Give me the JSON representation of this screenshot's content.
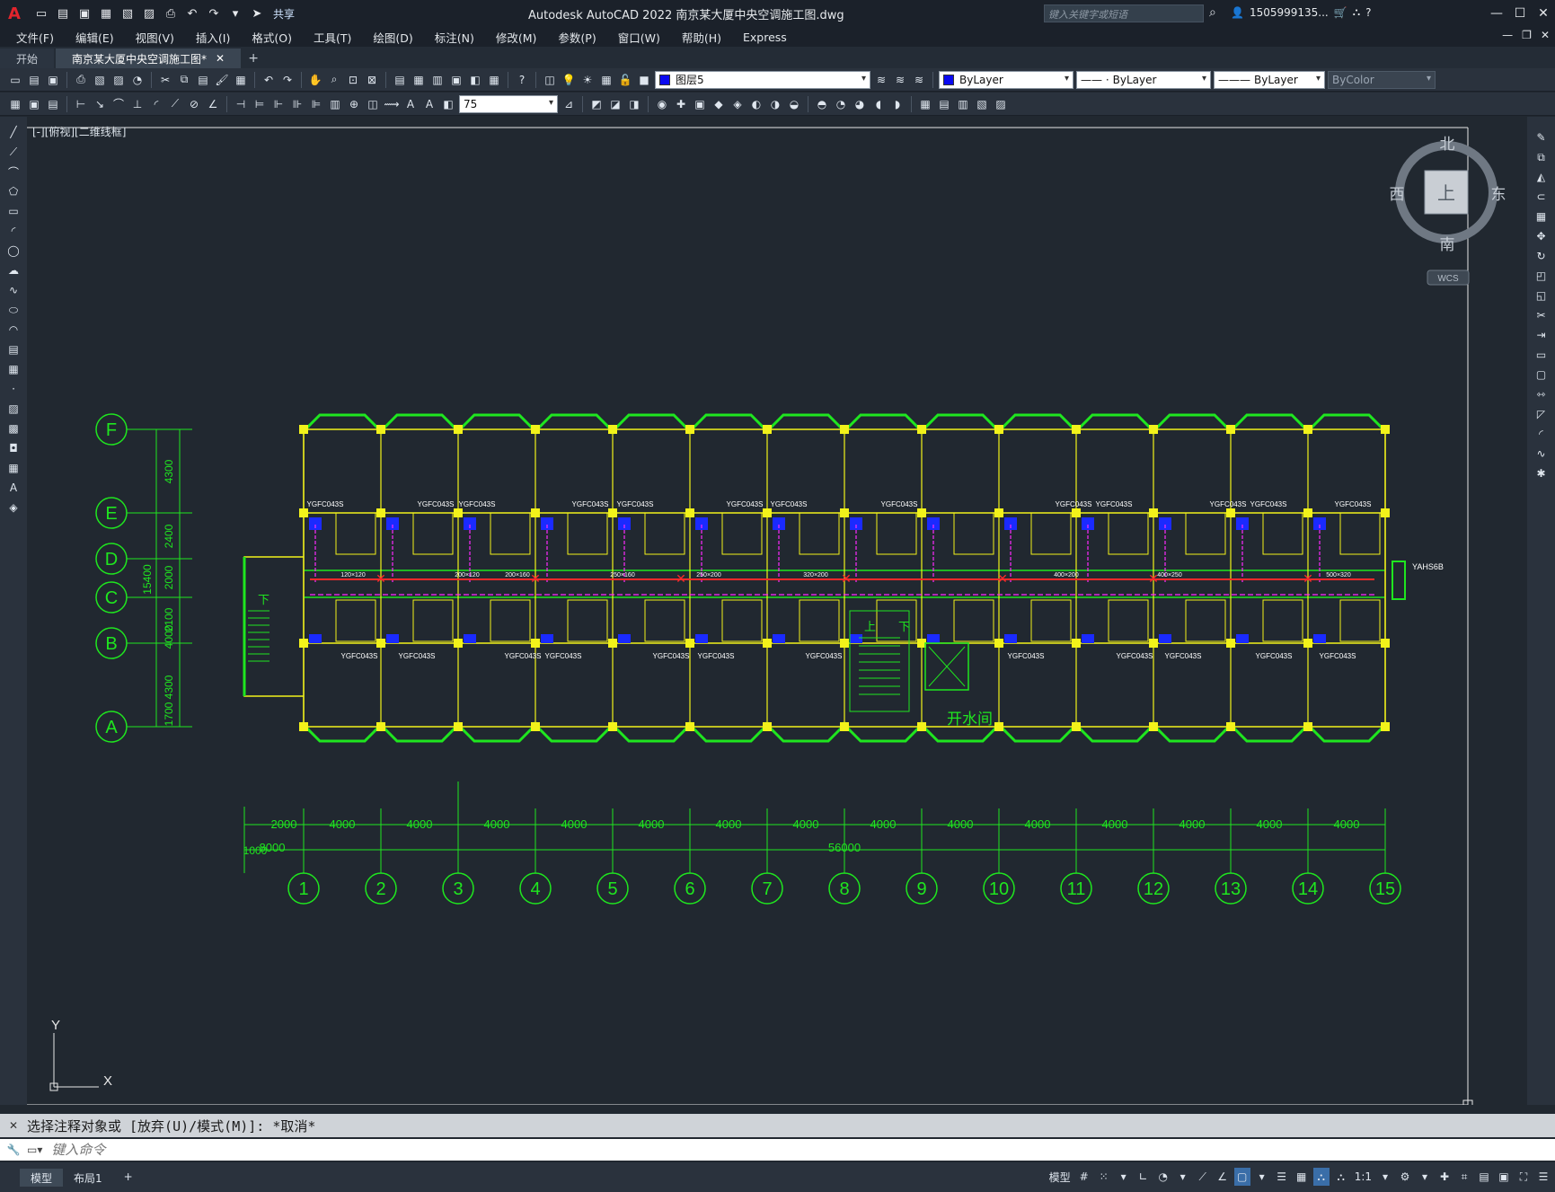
{
  "app": {
    "title": "Autodesk AutoCAD 2022    南京某大厦中央空调施工图.dwg",
    "share_label": "共享",
    "search_placeholder": "键入关键字或短语",
    "user": "1505999135...",
    "menus": [
      "文件(F)",
      "编辑(E)",
      "视图(V)",
      "插入(I)",
      "格式(O)",
      "工具(T)",
      "绘图(D)",
      "标注(N)",
      "修改(M)",
      "参数(P)",
      "窗口(W)",
      "帮助(H)",
      "Express"
    ]
  },
  "tabs": {
    "start": "开始",
    "active": "南京某大厦中央空调施工图*",
    "close": "✕",
    "add": "+"
  },
  "toolbar": {
    "layer": "图层5",
    "color": "ByLayer",
    "linetype": "ByLayer",
    "lineweight": "ByLayer",
    "plotstyle": "ByColor",
    "dim_scale": "75"
  },
  "viewport": {
    "label": "[-][俯视][二维线框]"
  },
  "viewcube": {
    "north": "北",
    "south": "南",
    "east": "东",
    "west": "西",
    "face": "上",
    "wcs": "WCS"
  },
  "drawing": {
    "row_axes": [
      "F",
      "E",
      "D",
      "C",
      "B",
      "A"
    ],
    "col_axes": [
      "1",
      "2",
      "3",
      "4",
      "5",
      "6",
      "7",
      "8",
      "9",
      "10",
      "11",
      "12",
      "13",
      "14",
      "15"
    ],
    "row_dims": [
      "4300",
      "2400",
      "2000",
      "2100",
      "4000",
      "4300",
      "1700"
    ],
    "total_row_dim": "15400",
    "col_dims": [
      "4000",
      "4000",
      "4000",
      "4000",
      "4000",
      "4000",
      "4000",
      "4000",
      "4000",
      "4000",
      "4000",
      "4000",
      "4000",
      "4000"
    ],
    "first_dim": "2000",
    "second_dim": "8000",
    "third_dim": "1000",
    "total_col_dim": "56000",
    "room_label": "开水间",
    "stair_up": "上",
    "stair_down": "下",
    "stair_left": "下",
    "fcu_label": "YGFC043S",
    "unit_label": "YAHS6B",
    "duct_sizes": [
      "120×120",
      "200×120",
      "200×160",
      "250×160",
      "250×200",
      "320×200",
      "400×200",
      "400×250",
      "500×320"
    ],
    "ucs_x": "X",
    "ucs_y": "Y"
  },
  "command": {
    "output": "选择注释对象或 [放弃(U)/模式(M)]: *取消*",
    "input_placeholder": "键入命令"
  },
  "status": {
    "model_tab": "模型",
    "layout_tab": "布局1",
    "add_tab": "+",
    "model_button": "模型",
    "scale": "1:1"
  },
  "colors": {
    "bg": "#212830",
    "green": "#1fe61f",
    "yellow": "#f2f21a",
    "red": "#ff2a2a",
    "magenta": "#ff2aff",
    "blue": "#1a2aff"
  }
}
